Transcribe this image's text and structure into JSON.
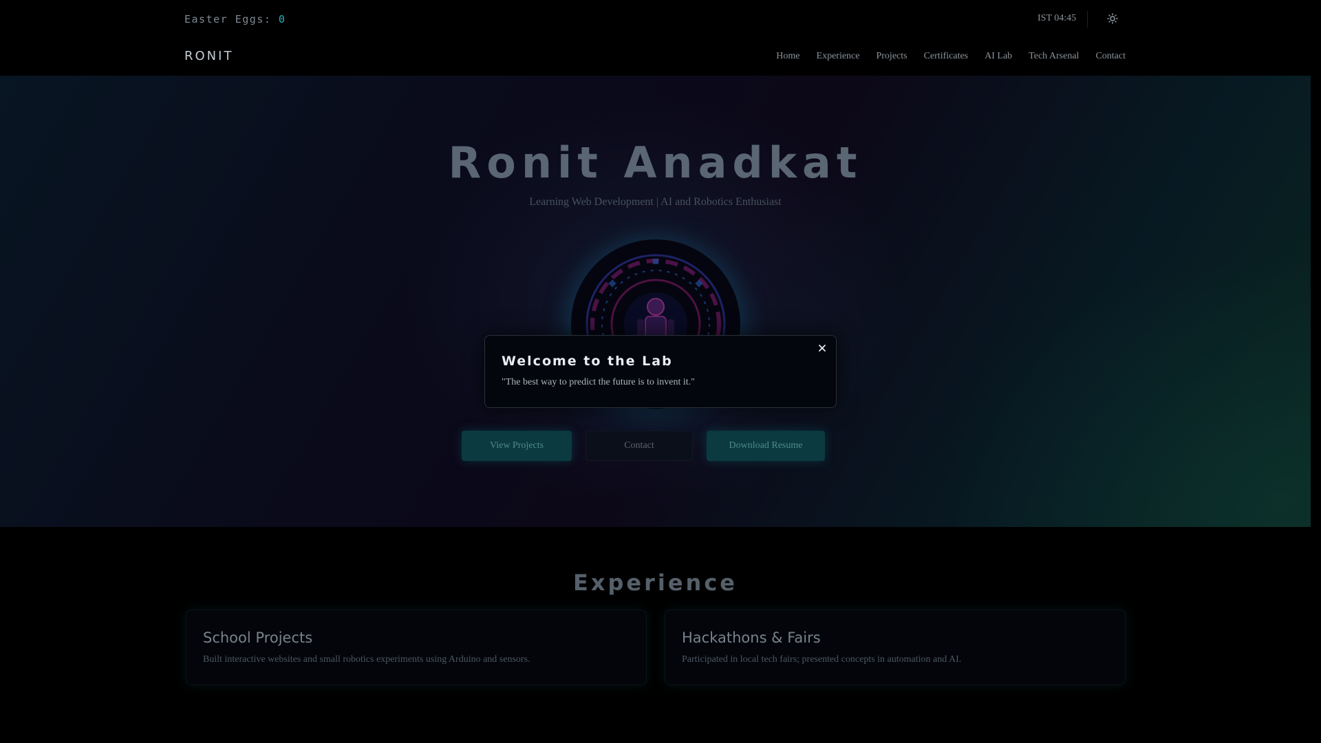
{
  "topbar": {
    "eggs_label": "Easter Eggs:",
    "eggs_count": "0",
    "clock": "IST 04:45",
    "theme_icon": "sun-icon"
  },
  "nav": {
    "brand": "RONIT",
    "links": [
      "Home",
      "Experience",
      "Projects",
      "Certificates",
      "AI Lab",
      "Tech Arsenal",
      "Contact"
    ]
  },
  "hero": {
    "title": "Ronit Anadkat",
    "subtitle": "Learning Web Development | AI and Robotics Enthusiast",
    "avatar_icon": "robot-avatar-icon",
    "buttons": {
      "view_projects": "View Projects",
      "contact": "Contact",
      "download_resume": "Download Resume"
    }
  },
  "experience": {
    "title": "Experience",
    "cards": [
      {
        "title": "School Projects",
        "text": "Built interactive websites and small robotics experiments using Arduino and sensors."
      },
      {
        "title": "Hackathons & Fairs",
        "text": "Participated in local tech fairs; presented concepts in automation and AI."
      }
    ]
  },
  "modal": {
    "title": "Welcome to the Lab",
    "quote": "\"The best way to predict the future is to invent it.\"",
    "close_icon": "close-icon"
  },
  "colors": {
    "accent": "#1fb3c4",
    "background": "#000000",
    "button_primary": "#0b3a40"
  }
}
